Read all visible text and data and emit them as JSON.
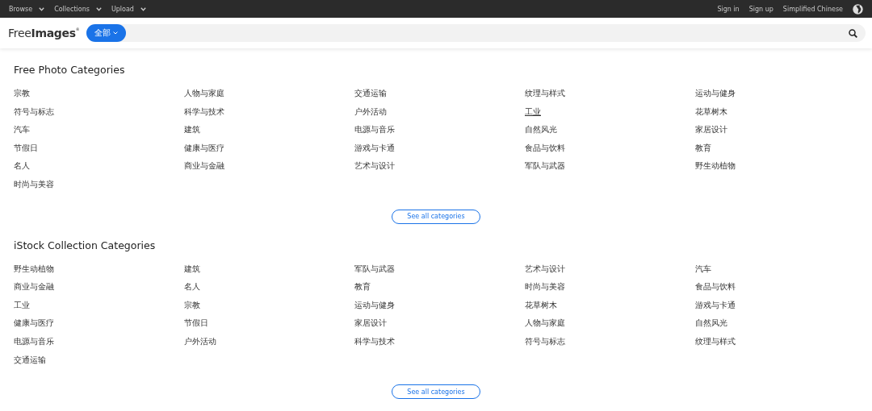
{
  "top_nav": {
    "left": [
      {
        "label": "Browse"
      },
      {
        "label": "Collections"
      },
      {
        "label": "Upload"
      }
    ],
    "right": [
      {
        "label": "Sign in"
      },
      {
        "label": "Sign up"
      },
      {
        "label": "Simplified Chinese"
      }
    ]
  },
  "header": {
    "logo": {
      "light": "Free",
      "bold": "Images",
      "mark": "®"
    },
    "search": {
      "scope": "全部"
    }
  },
  "sections": [
    {
      "title": "Free Photo Categories",
      "button": "See all categories",
      "items": [
        {
          "label": "宗教",
          "hovered": false
        },
        {
          "label": "人物与家庭",
          "hovered": false
        },
        {
          "label": "交通运输",
          "hovered": false
        },
        {
          "label": "纹理与样式",
          "hovered": false
        },
        {
          "label": "运动与健身",
          "hovered": false
        },
        {
          "label": "符号与标志",
          "hovered": false
        },
        {
          "label": "科学与技术",
          "hovered": false
        },
        {
          "label": "户外活动",
          "hovered": false
        },
        {
          "label": "工业",
          "hovered": true
        },
        {
          "label": "花草树木",
          "hovered": false
        },
        {
          "label": "汽车",
          "hovered": false
        },
        {
          "label": "建筑",
          "hovered": false
        },
        {
          "label": "电源与音乐",
          "hovered": false
        },
        {
          "label": "自然风光",
          "hovered": false
        },
        {
          "label": "家居设计",
          "hovered": false
        },
        {
          "label": "节假日",
          "hovered": false
        },
        {
          "label": "健康与医疗",
          "hovered": false
        },
        {
          "label": "游戏与卡通",
          "hovered": false
        },
        {
          "label": "食品与饮料",
          "hovered": false
        },
        {
          "label": "教育",
          "hovered": false
        },
        {
          "label": "名人",
          "hovered": false
        },
        {
          "label": "商业与金融",
          "hovered": false
        },
        {
          "label": "艺术与设计",
          "hovered": false
        },
        {
          "label": "军队与武器",
          "hovered": false
        },
        {
          "label": "野生动植物",
          "hovered": false
        },
        {
          "label": "时尚与美容",
          "hovered": false
        }
      ]
    },
    {
      "title": "iStock Collection Categories",
      "button": "See all categories",
      "items": [
        {
          "label": "野生动植物",
          "hovered": false
        },
        {
          "label": "建筑",
          "hovered": false
        },
        {
          "label": "军队与武器",
          "hovered": false
        },
        {
          "label": "艺术与设计",
          "hovered": false
        },
        {
          "label": "汽车",
          "hovered": false
        },
        {
          "label": "商业与金融",
          "hovered": false
        },
        {
          "label": "名人",
          "hovered": false
        },
        {
          "label": "教育",
          "hovered": false
        },
        {
          "label": "时尚与美容",
          "hovered": false
        },
        {
          "label": "食品与饮料",
          "hovered": false
        },
        {
          "label": "工业",
          "hovered": false
        },
        {
          "label": "宗教",
          "hovered": false
        },
        {
          "label": "运动与健身",
          "hovered": false
        },
        {
          "label": "花草树木",
          "hovered": false
        },
        {
          "label": "游戏与卡通",
          "hovered": false
        },
        {
          "label": "健康与医疗",
          "hovered": false
        },
        {
          "label": "节假日",
          "hovered": false
        },
        {
          "label": "家居设计",
          "hovered": false
        },
        {
          "label": "人物与家庭",
          "hovered": false
        },
        {
          "label": "自然风光",
          "hovered": false
        },
        {
          "label": "电源与音乐",
          "hovered": false
        },
        {
          "label": "户外活动",
          "hovered": false
        },
        {
          "label": "科学与技术",
          "hovered": false
        },
        {
          "label": "符号与标志",
          "hovered": false
        },
        {
          "label": "纹理与样式",
          "hovered": false
        },
        {
          "label": "交通运输",
          "hovered": false
        }
      ]
    }
  ]
}
